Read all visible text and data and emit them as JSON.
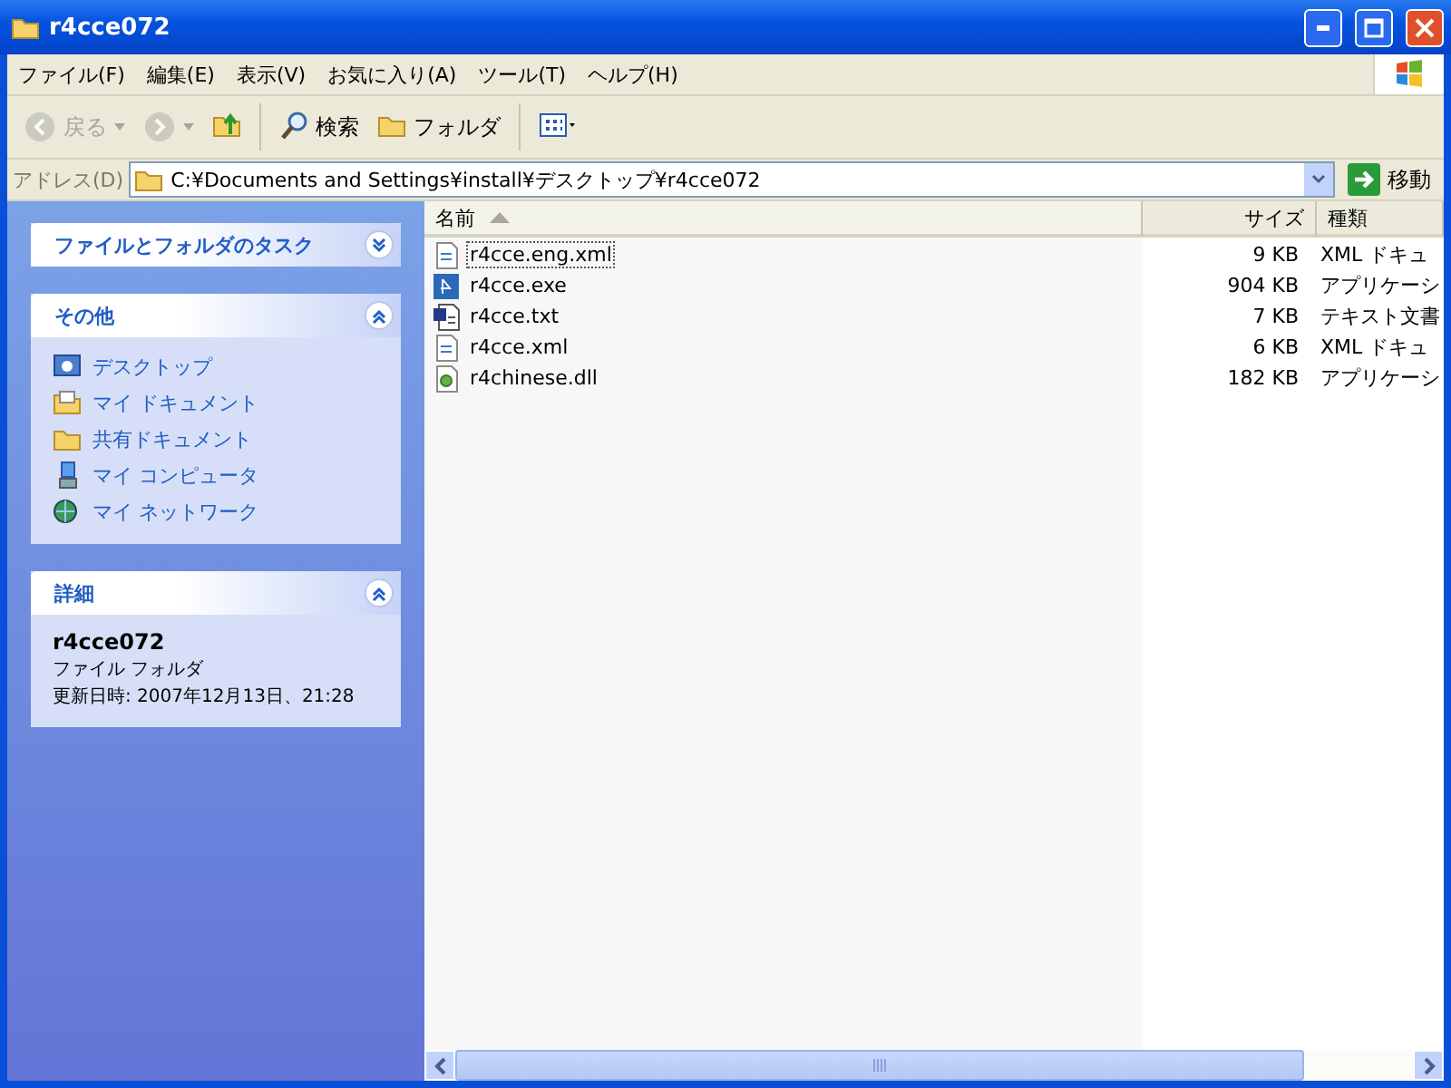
{
  "window": {
    "title": "r4cce072"
  },
  "menu": [
    "ファイル(F)",
    "編集(E)",
    "表示(V)",
    "お気に入り(A)",
    "ツール(T)",
    "ヘルプ(H)"
  ],
  "toolbar": [
    {
      "kind": "back",
      "label": "戻る",
      "disabled": true
    },
    {
      "kind": "forward",
      "disabled": true
    },
    {
      "kind": "up",
      "disabled": false
    },
    {
      "kind": "search",
      "label": "検索",
      "disabled": false
    },
    {
      "kind": "folders",
      "label": "フォルダ",
      "disabled": false
    },
    {
      "kind": "views",
      "disabled": false
    }
  ],
  "address": {
    "label": "アドレス(D)",
    "value": "C:¥Documents and Settings¥install¥デスクトップ¥r4cce072",
    "go": "移動"
  },
  "sidebar": [
    {
      "title": "ファイルとフォルダのタスク",
      "expanded": false
    },
    {
      "title": "その他",
      "expanded": true,
      "items": [
        {
          "kind": "desktop",
          "label": "デスクトップ"
        },
        {
          "kind": "documents",
          "label": "マイ ドキュメント"
        },
        {
          "kind": "folder",
          "label": "共有ドキュメント"
        },
        {
          "kind": "computer",
          "label": "マイ コンピュータ"
        },
        {
          "kind": "network",
          "label": "マイ ネットワーク"
        }
      ]
    },
    {
      "title": "詳細",
      "expanded": true,
      "name": "r4cce072",
      "type": "ファイル フォルダ",
      "modified": "更新日時: 2007年12月13日、21:28"
    }
  ],
  "table": {
    "columns": [
      {
        "label": "名前",
        "sorted": true
      },
      {
        "label": "サイズ",
        "sorted": false
      },
      {
        "label": "種類",
        "sorted": false
      }
    ],
    "rows": [
      {
        "kind": "xml",
        "name": "r4cce.eng.xml",
        "size": "9 KB",
        "type": "XML ドキュ",
        "focused": true
      },
      {
        "kind": "exe",
        "name": "r4cce.exe",
        "size": "904 KB",
        "type": "アプリケーシ",
        "focused": false
      },
      {
        "kind": "txt",
        "name": "r4cce.txt",
        "size": "7 KB",
        "type": "テキスト文書",
        "focused": false
      },
      {
        "kind": "xml",
        "name": "r4cce.xml",
        "size": "6 KB",
        "type": "XML ドキュ",
        "focused": false
      },
      {
        "kind": "dll",
        "name": "r4chinese.dll",
        "size": "182 KB",
        "type": "アプリケーシ",
        "focused": false
      }
    ]
  }
}
